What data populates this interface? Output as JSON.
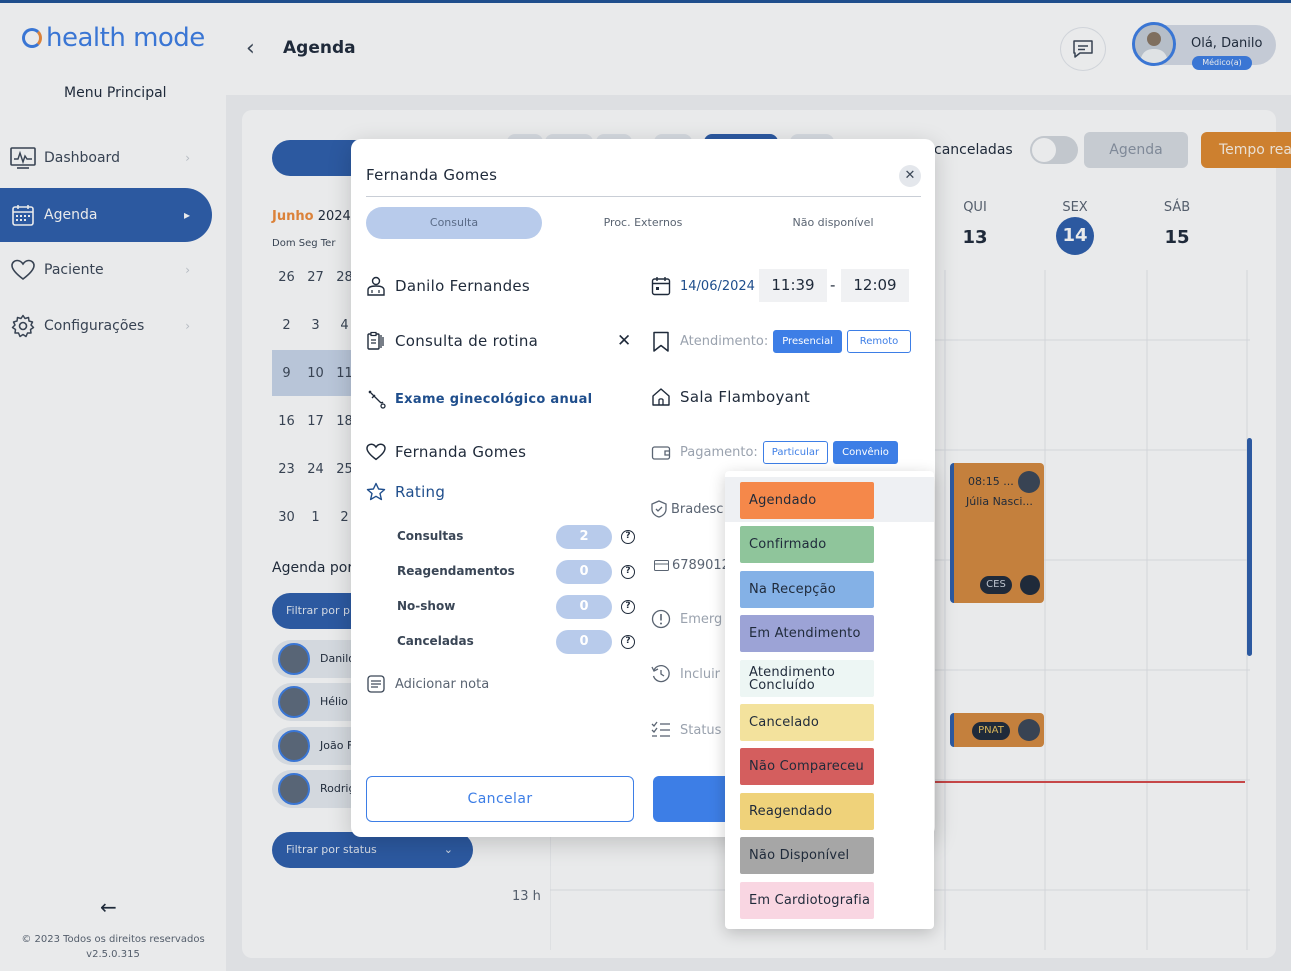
{
  "app": {
    "brand": "health mode",
    "menu_title": "Menu Principal"
  },
  "sidebar": {
    "items": [
      {
        "label": "Dashboard",
        "icon": "dashboard-icon"
      },
      {
        "label": "Agenda",
        "icon": "calendar-icon",
        "active": true
      },
      {
        "label": "Paciente",
        "icon": "heart-icon"
      },
      {
        "label": "Configurações",
        "icon": "gear-icon"
      }
    ],
    "footer_copyright": "© 2023 Todos os direitos reservados",
    "footer_version": "v2.5.0.315"
  },
  "header": {
    "title": "Agenda",
    "greeting": "Olá, Danilo",
    "role": "Médico(a)"
  },
  "calendar": {
    "month": "Junho",
    "year": "2024",
    "dow": "Dom Seg Ter",
    "rows": [
      [
        "26",
        "27",
        "28"
      ],
      [
        "2",
        "3",
        "4"
      ],
      [
        "9",
        "10",
        "11"
      ],
      [
        "16",
        "17",
        "18"
      ],
      [
        "23",
        "24",
        "25"
      ],
      [
        "30",
        "1",
        "2"
      ]
    ],
    "agenda_por": "Agenda por",
    "filter_prof_placeholder": "Filtrar por pr",
    "doctors": [
      "Danilo",
      "Hélio S",
      "João F",
      "Rodrig"
    ],
    "filter_status": "Filtrar por status"
  },
  "toolbar": {
    "canceled_label": "canceladas",
    "agenda_btn": "Agenda",
    "realtime_btn": "Tempo real"
  },
  "week": [
    {
      "name": "QUI",
      "date": "13"
    },
    {
      "name": "SEX",
      "date": "14",
      "today": true
    },
    {
      "name": "SÁB",
      "date": "15"
    }
  ],
  "grid": {
    "hour_label": "13 h"
  },
  "appointments": [
    {
      "time": "08:15 ...",
      "name": "Júlia Nasci...",
      "badge": "CES"
    },
    {
      "badge": "PNAT"
    }
  ],
  "modal": {
    "title": "Fernanda Gomes",
    "tabs": [
      "Consulta",
      "Proc. Externos",
      "Não disponível"
    ],
    "doctor": "Danilo Fernandes",
    "procedure": "Consulta de rotina",
    "exam": "Exame ginecológico anual",
    "patient": "Fernanda Gomes",
    "rating_label": "Rating",
    "stats": [
      {
        "label": "Consultas",
        "value": "2"
      },
      {
        "label": "Reagendamentos",
        "value": "0"
      },
      {
        "label": "No-show",
        "value": "0"
      },
      {
        "label": "Canceladas",
        "value": "0"
      }
    ],
    "add_note": "Adicionar nota",
    "date": "14/06/2024 ,",
    "time_start": "11:39",
    "time_sep": "-",
    "time_end": "12:09",
    "attendance_label": "Atendimento:",
    "attendance_options": [
      "Presencial",
      "Remoto"
    ],
    "room": "Sala Flamboyant",
    "payment_label": "Pagamento:",
    "payment_options": [
      "Particular",
      "Convênio"
    ],
    "insurance": "Bradesc",
    "card_number": "6789012",
    "emergency": "Emerg",
    "include": "Incluir",
    "status": "Status",
    "cancel_btn": "Cancelar"
  },
  "status_dropdown": [
    {
      "label": "Agendado",
      "color": "#f5884a"
    },
    {
      "label": "Confirmado",
      "color": "#8fc59b"
    },
    {
      "label": "Na Recepção",
      "color": "#84b1e6"
    },
    {
      "label": "Em Atendimento",
      "color": "#9ca3d6"
    },
    {
      "label": "Atendimento Concluído",
      "color": "#edf6f4"
    },
    {
      "label": "Cancelado",
      "color": "#f3e29d"
    },
    {
      "label": "Não Compareceu",
      "color": "#d45e5e"
    },
    {
      "label": "Reagendado",
      "color": "#efd27a"
    },
    {
      "label": "Não Disponível",
      "color": "#a6a6a6"
    },
    {
      "label": "Em Cardiotografia",
      "color": "#f9d6e2"
    }
  ]
}
